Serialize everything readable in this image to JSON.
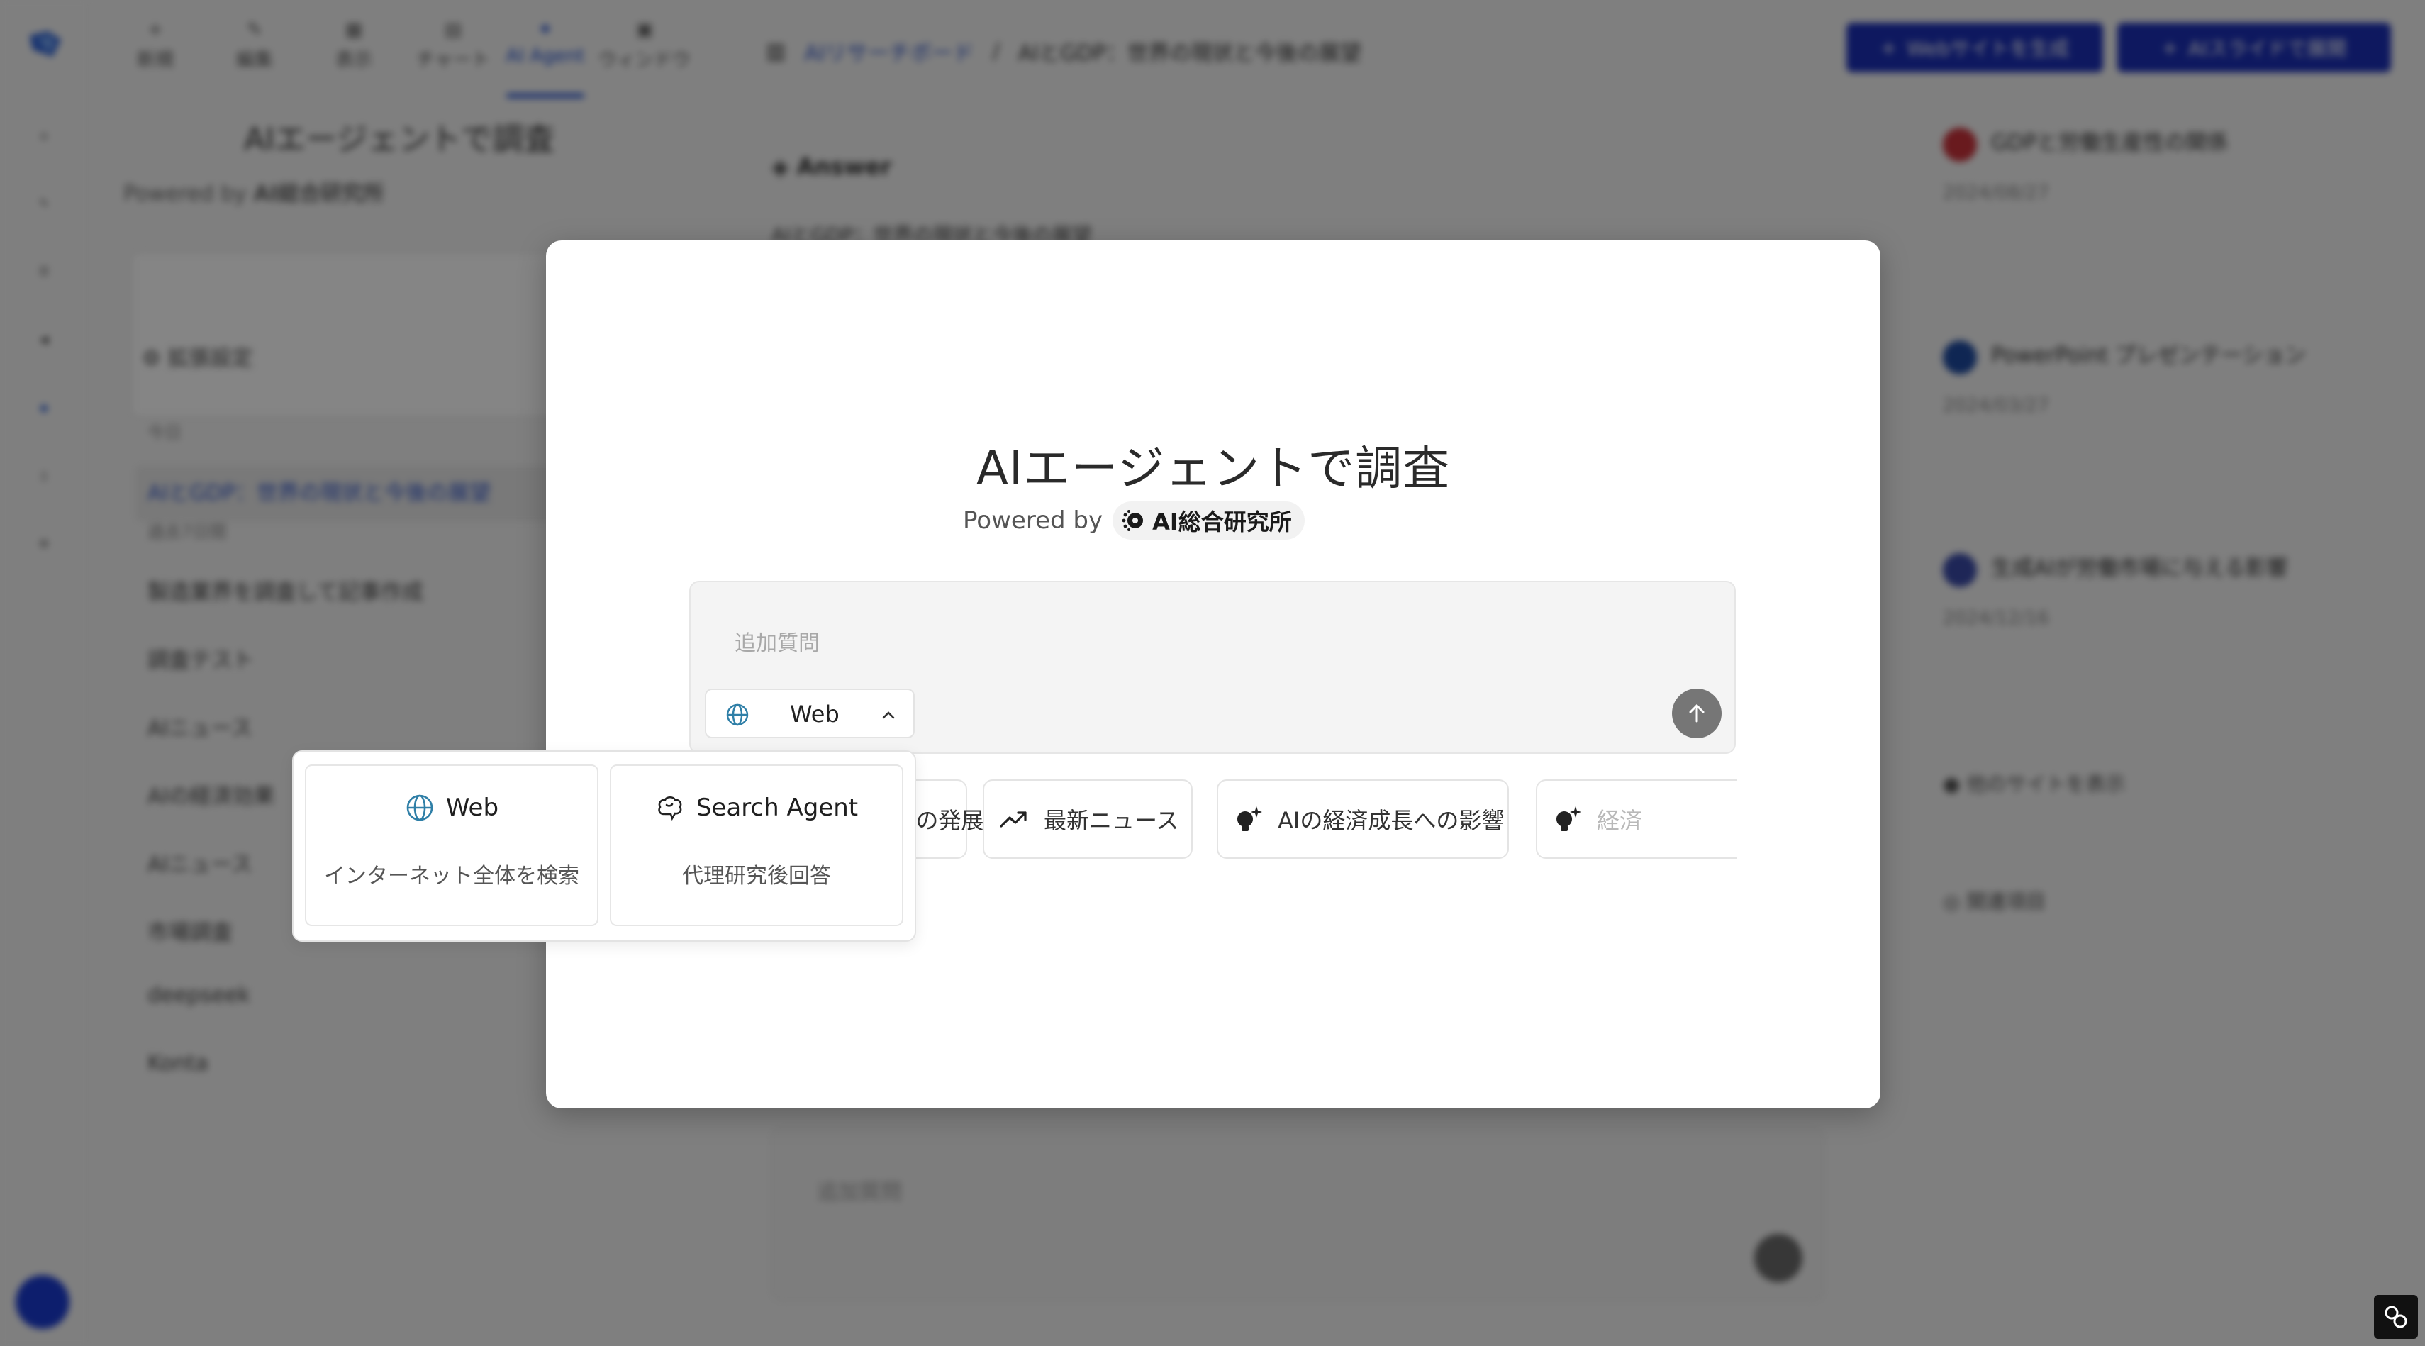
{
  "background": {
    "toolbar": [
      {
        "label": "新規"
      },
      {
        "label": "編集"
      },
      {
        "label": "表示"
      },
      {
        "label": "チャート"
      },
      {
        "label": "AI Agent"
      },
      {
        "label": "ウィンドウ"
      }
    ],
    "breadcrumb": {
      "parent": "AIリサーチボード",
      "current": "AIとGDP：世界の現状と今後の展望"
    },
    "header_buttons": [
      {
        "label": "Webサイトを生成"
      },
      {
        "label": "AIスライドで展開"
      }
    ],
    "left_panel": {
      "title": "AIエージェントで調査",
      "powered": "Powered by",
      "brand": "AI総合研究所",
      "settings": "拡張設定",
      "section_today": "今日",
      "selected_item": "AIとGDP：世界の現状と今後の展望",
      "section_week": "過去7日間",
      "items": [
        "製造業界を調査して記事作成",
        "調査テスト",
        "AIニュース",
        "AIの経済効果",
        "AIニュース",
        "市場調査",
        "deepseek",
        "Konta"
      ]
    },
    "main": {
      "answer_label": "Answer",
      "question_label": "AIとGDP：世界の現状と今後の展望",
      "followup_placeholder": "追加質問"
    },
    "right_panel": {
      "cards": [
        {
          "title": "GDPと労働生産性の関係",
          "desc": "2024/08/27"
        },
        {
          "title": "PowerPoint プレゼンテーション",
          "desc": "2024/03/27"
        },
        {
          "title": "生成AIが労働市場に与える影響",
          "desc": "2024/12/16"
        }
      ],
      "more": "他のサイトを表示",
      "related": "関連項目"
    }
  },
  "modal": {
    "title": "AIエージェントで調査",
    "powered_by": "Powered by",
    "brand": "AI総合研究所",
    "input": {
      "placeholder": "追加質問",
      "value": ""
    },
    "mode": {
      "selected": "Web",
      "chevron": "chevron-up-icon"
    },
    "send_icon": "arrow-up-icon",
    "suggestions": [
      {
        "label": "AIの発展",
        "icon": "arrow-up-right-icon"
      },
      {
        "label": "最新ニュース",
        "icon": "trend-up-icon"
      },
      {
        "label": "AIの経済成長への影響",
        "icon": "lightbulb-sparkle-icon"
      },
      {
        "label": "経済",
        "icon": "lightbulb-sparkle-icon"
      }
    ]
  },
  "dropdown": {
    "options": [
      {
        "title": "Web",
        "desc": "インターネット全体を検索",
        "icon": "globe-icon"
      },
      {
        "title": "Search Agent",
        "desc": "代理研究後回答",
        "icon": "brain-icon"
      }
    ]
  },
  "colors": {
    "accent": "#1a4bd1",
    "globe": "#2f7fa7",
    "overlay": "rgba(0,0,0,0.48)"
  }
}
